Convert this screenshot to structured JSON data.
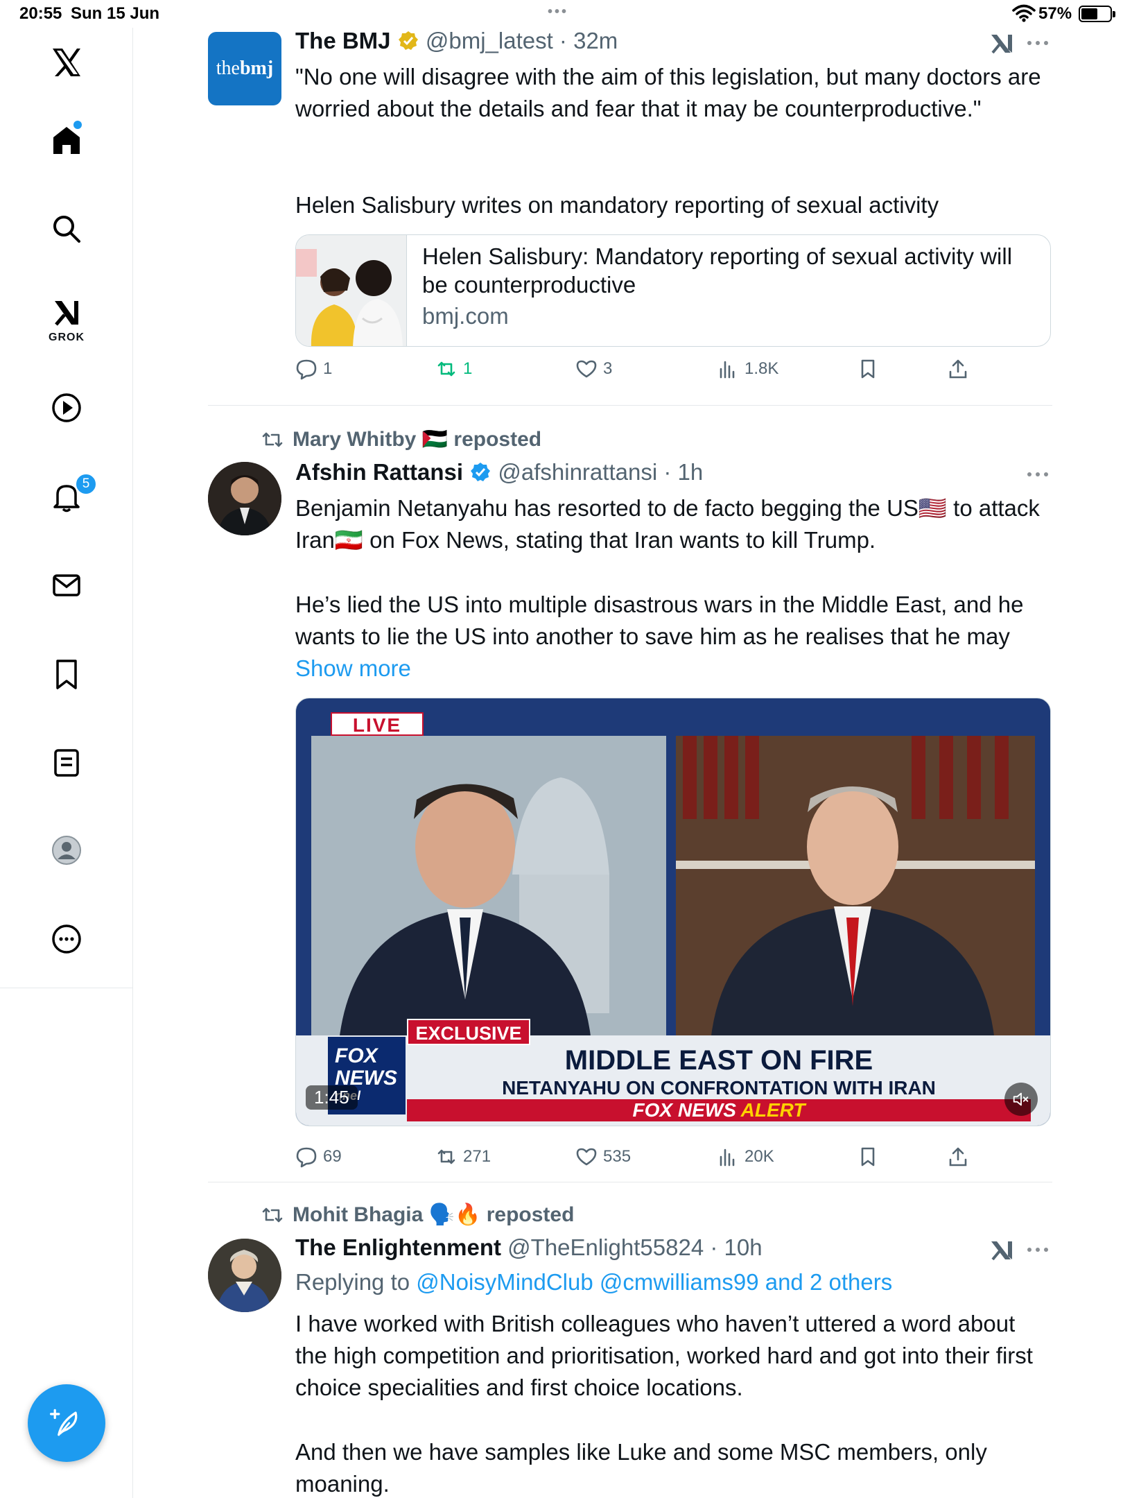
{
  "status": {
    "time": "20:55",
    "date": "Sun 15 Jun",
    "battery": "57%",
    "battery_level": 0.57
  },
  "sidebar": {
    "items": [
      {
        "name": "x-logo"
      },
      {
        "name": "home",
        "active": true
      },
      {
        "name": "search"
      },
      {
        "name": "grok",
        "label": "GROK"
      },
      {
        "name": "video"
      },
      {
        "name": "notifications",
        "badge": "5"
      },
      {
        "name": "messages"
      },
      {
        "name": "bookmarks"
      },
      {
        "name": "lists"
      },
      {
        "name": "profile"
      },
      {
        "name": "more"
      }
    ]
  },
  "colors": {
    "accent": "#1d9bf0",
    "muted": "#536471",
    "repost_active": "#00ba7c",
    "divider": "#e6e9eb"
  },
  "tweets": [
    {
      "author_name": "The BMJ",
      "verified": "gold",
      "handle": "@bmj_latest",
      "time": "32m",
      "avatar_text": "thebmj",
      "avatar_text_a": "the",
      "avatar_text_b": "bmj",
      "body_1": "\"No one will disagree with the aim of this legislation, but many doctors are worried about the details and fear that it may be counterproductive.\"",
      "body_2": "Helen Salisbury writes on mandatory reporting of sexual activity",
      "card": {
        "title": "Helen Salisbury: Mandatory reporting of sexual activity will be counterproductive",
        "domain": "bmj.com"
      },
      "actions": {
        "replies": "1",
        "reposts": "1",
        "likes": "3",
        "views": "1.8K"
      }
    },
    {
      "reposted_by": "Mary Whitby 🇵🇸",
      "reposted_suffix": "reposted",
      "author_name": "Afshin Rattansi",
      "verified": "blue",
      "handle": "@afshinrattansi",
      "time": "1h",
      "body_1a": "Benjamin Netanyahu has resorted to de facto begging the US🇺🇸 to attack Iran🇮🇷 on Fox News, stating that Iran wants to kill Trump.",
      "body_2": "He’s lied the US into multiple disastrous wars in the Middle East, and he wants to lie the US into another to save him as he realises that he may",
      "show_more": "Show more",
      "video": {
        "live": "LIVE",
        "exclusive": "EXCLUSIVE",
        "logo_1": "FOX",
        "logo_2": "NEWS",
        "logo_3": "nnel",
        "headline": "MIDDLE EAST ON FIRE",
        "subhead": "NETANYAHU ON CONFRONTATION WITH IRAN",
        "alert_a": "FOX NEWS",
        "alert_b": "ALERT",
        "duration": "1:45"
      },
      "actions": {
        "replies": "69",
        "reposts": "271",
        "likes": "535",
        "views": "20K"
      }
    },
    {
      "reposted_by": "Mohit Bhagia 🗣️🔥",
      "reposted_suffix": "reposted",
      "author_name": "The Enlightenment",
      "handle": "@TheEnlight55824",
      "time": "10h",
      "replying_prefix": "Replying to",
      "replying_to": "@NoisyMindClub @cmwilliams99 and 2 others",
      "body_1": "I have worked with British colleagues who haven’t uttered a word about the high competition and prioritisation, worked hard and got into their first choice specialities and first choice locations.",
      "body_2": "And then we have samples like Luke and some MSC members, only moaning."
    }
  ]
}
